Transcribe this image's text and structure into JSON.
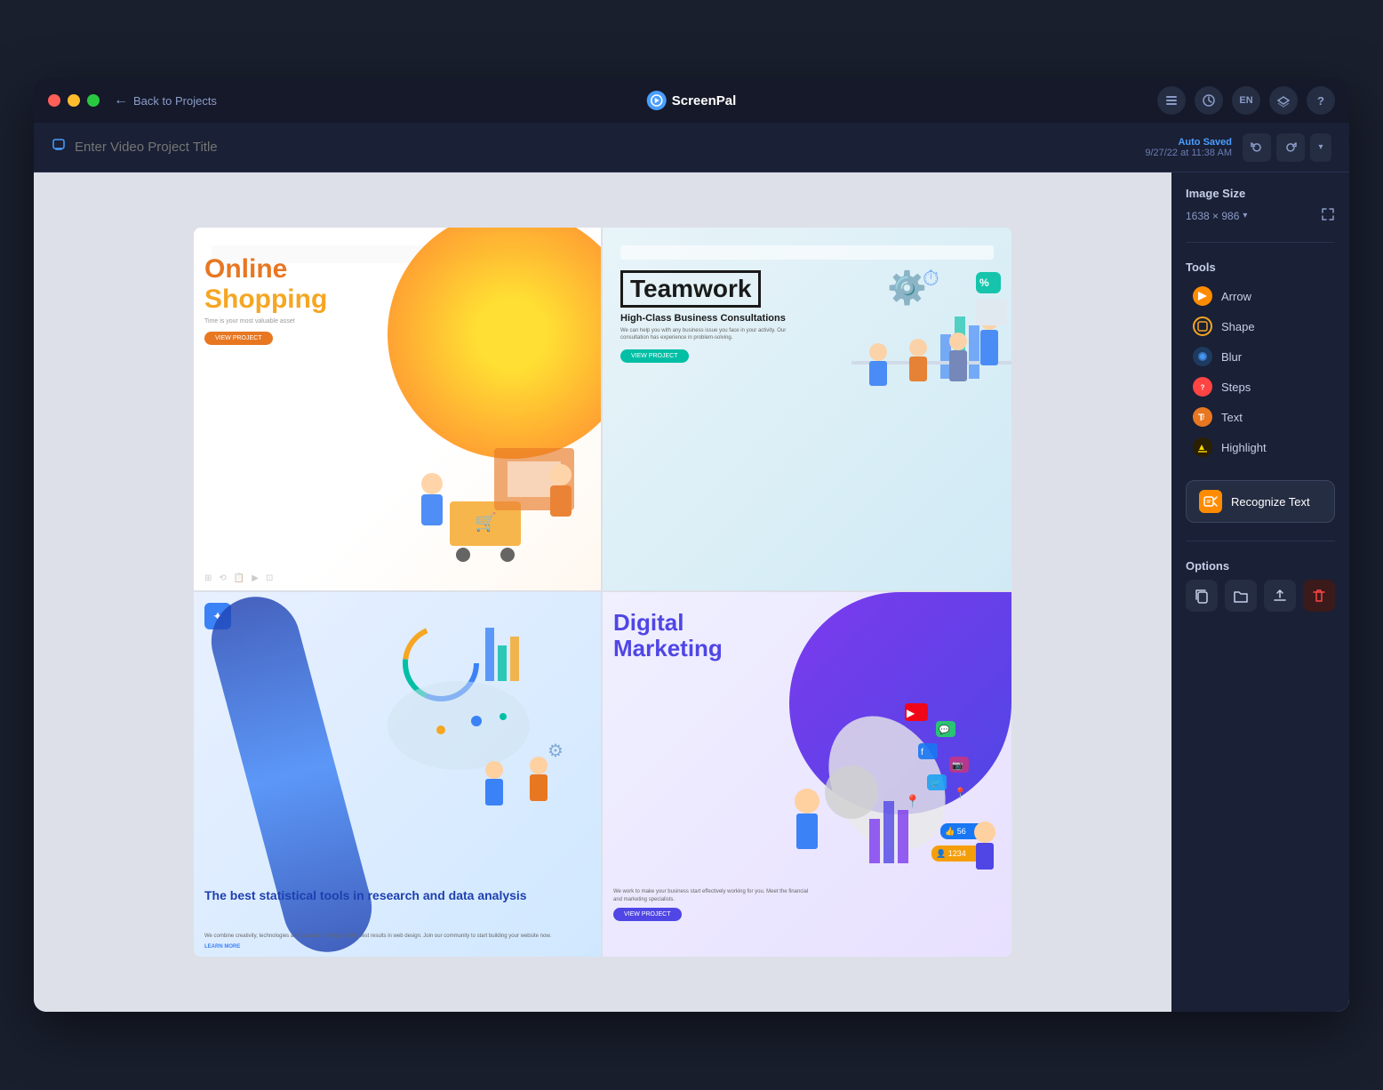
{
  "app": {
    "title": "ScreenPal",
    "logo_symbol": "🎬"
  },
  "title_bar": {
    "back_label": "Back to Projects",
    "traffic_lights": [
      "red",
      "yellow",
      "green"
    ],
    "actions": [
      "list-icon",
      "clock-icon",
      "EN",
      "layers-icon",
      "help-icon"
    ]
  },
  "project_title": {
    "placeholder": "Enter Video Project Title",
    "auto_saved_label": "Auto Saved",
    "auto_saved_time": "9/27/22 at 11:38 AM"
  },
  "canvas": {
    "slides": [
      {
        "id": "slide-1",
        "type": "online-shopping",
        "title1": "Online",
        "title2": "Shopping",
        "description": "Time is your most valuable asset",
        "button_label": "VIEW PROJECT"
      },
      {
        "id": "slide-2",
        "type": "teamwork",
        "title": "Teamwork",
        "subtitle": "High-Class Business Consultations",
        "description": "We can help you with any business issue you face in your activity. Our consultation has experience in problem-solving.",
        "button_label": "VIEW PROJECT"
      },
      {
        "id": "slide-3",
        "type": "statistics",
        "title": "The best statistical tools in research and data analysis",
        "description": "We combine creativity, technologies and passion to bring you the best results in web design. Join our community to start building your website now.",
        "link_label": "LEARN MORE"
      },
      {
        "id": "slide-4",
        "type": "digital-marketing",
        "title1": "Digital",
        "title2": "Marketing",
        "description": "We work to make your business start effectively working for you. Meet the financial and marketing specialists.",
        "button_label": "VIEW PROJECT"
      }
    ]
  },
  "right_panel": {
    "image_size_label": "Image Size",
    "image_size_value": "1638 × 986",
    "tools_label": "Tools",
    "tools": [
      {
        "id": "arrow",
        "label": "Arrow",
        "icon_type": "arrow",
        "color": "#ff8c00"
      },
      {
        "id": "shape",
        "label": "Shape",
        "icon_type": "shape",
        "color": "#f5a623"
      },
      {
        "id": "blur",
        "label": "Blur",
        "icon_type": "blur",
        "color": "#4a9eff"
      },
      {
        "id": "steps",
        "label": "Steps",
        "icon_type": "steps",
        "color": "#ff4444"
      },
      {
        "id": "text",
        "label": "Text",
        "icon_type": "text",
        "color": "#e87722"
      },
      {
        "id": "highlight",
        "label": "Highlight",
        "icon_type": "highlight",
        "color": "#ffd700"
      }
    ],
    "recognize_text_label": "Recognize Text",
    "options_label": "Options",
    "option_buttons": [
      "copy",
      "open-folder",
      "upload",
      "delete"
    ]
  }
}
